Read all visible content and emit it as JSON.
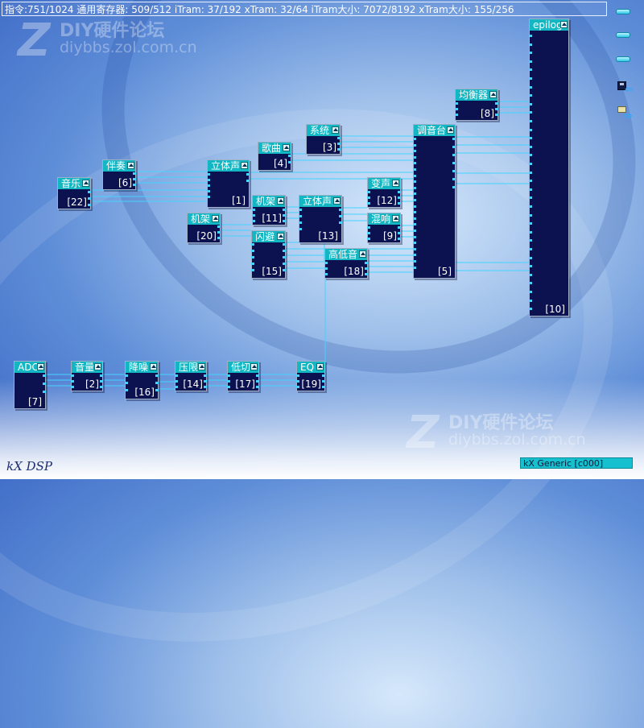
{
  "status": {
    "text": "指令:751/1024 通用寄存器: 509/512 iTram: 37/192 xTram: 32/64 iTram大小: 7072/8192 xTram大小: 155/256"
  },
  "watermark": {
    "title": "DIY硬件论坛",
    "url": "diybbs.zol.com.cn",
    "letter": "Z"
  },
  "wire_color": "#44d3ff",
  "node_body_color": "#0c1150",
  "node_header_color": "#12b7c3",
  "nodes": [
    {
      "id": "epilog",
      "name": "epilog",
      "index": "[10]"
    },
    {
      "id": "eq8",
      "name": "均衡器",
      "index": "[8]"
    },
    {
      "id": "sys3",
      "name": "系统",
      "index": "[3]"
    },
    {
      "id": "mixer5",
      "name": "调音台",
      "index": "[5]"
    },
    {
      "id": "song4",
      "name": "歌曲",
      "index": "[4]"
    },
    {
      "id": "acc6",
      "name": "伴奏",
      "index": "[6]"
    },
    {
      "id": "st1",
      "name": "立体声",
      "index": "[1]"
    },
    {
      "id": "music22",
      "name": "音乐",
      "index": "[22]"
    },
    {
      "id": "voice12",
      "name": "变声",
      "index": "[12]"
    },
    {
      "id": "rack11",
      "name": "机架",
      "index": "[11]"
    },
    {
      "id": "st13",
      "name": "立体声",
      "index": "[13]"
    },
    {
      "id": "rev9",
      "name": "混响",
      "index": "[9]"
    },
    {
      "id": "rack20",
      "name": "机架",
      "index": "[20]"
    },
    {
      "id": "avoid15",
      "name": "闪避",
      "index": "[15]"
    },
    {
      "id": "hilo18",
      "name": "高低音",
      "index": "[18]"
    },
    {
      "id": "adc7",
      "name": "ADC",
      "index": "[7]"
    },
    {
      "id": "vol2",
      "name": "音量",
      "index": "[2]"
    },
    {
      "id": "nr16",
      "name": "降噪",
      "index": "[16]"
    },
    {
      "id": "lim14",
      "name": "压限",
      "index": "[14]"
    },
    {
      "id": "lc17",
      "name": "低切",
      "index": "[17]"
    },
    {
      "id": "eq19",
      "name": "EQ",
      "index": "[19]"
    }
  ],
  "side_icons": [
    "toolbar-bar-icon",
    "toolbar-bar-icon",
    "toolbar-bar-icon",
    "save-icon",
    "open-icon"
  ],
  "footer": {
    "brand": "kX DSP",
    "device": "kX Generic [c000]"
  }
}
